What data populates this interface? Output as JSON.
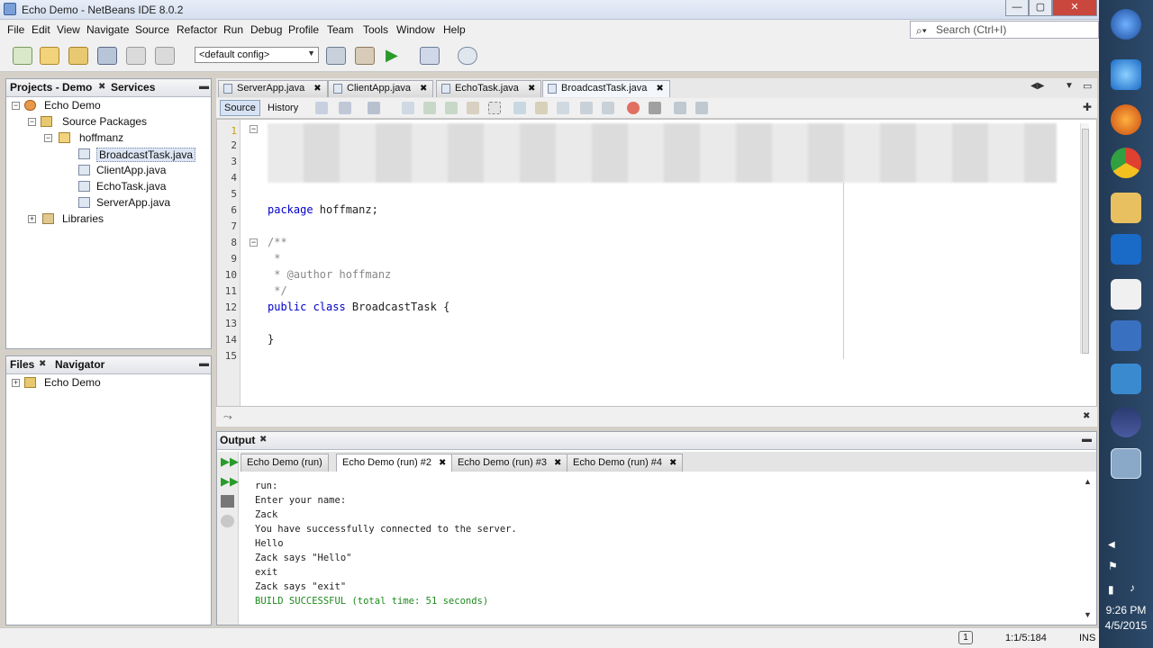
{
  "window": {
    "title": "Echo Demo - NetBeans IDE 8.0.2",
    "min_glyph": "—",
    "max_glyph": "▢",
    "close_glyph": "✕"
  },
  "menu": [
    "File",
    "Edit",
    "View",
    "Navigate",
    "Source",
    "Refactor",
    "Run",
    "Debug",
    "Profile",
    "Team",
    "Tools",
    "Window",
    "Help"
  ],
  "search": {
    "placeholder": "Search (Ctrl+I)"
  },
  "toolbar": {
    "config": "<default config>"
  },
  "projects_panel": {
    "tabs": [
      "Projects - Demo",
      "Services"
    ],
    "tree": {
      "project": "Echo Demo",
      "source_packages": "Source Packages",
      "package": "hoffmanz",
      "files": [
        "BroadcastTask.java",
        "ClientApp.java",
        "EchoTask.java",
        "ServerApp.java"
      ],
      "libraries": "Libraries"
    }
  },
  "files_panel": {
    "tabs": [
      "Files",
      "Navigator"
    ],
    "project": "Echo Demo"
  },
  "editor": {
    "tabs": [
      "ServerApp.java",
      "ClientApp.java",
      "EchoTask.java",
      "BroadcastTask.java"
    ],
    "active_tab": "BroadcastTask.java",
    "modes": [
      "Source",
      "History"
    ],
    "line_numbers": [
      "1",
      "2",
      "3",
      "4",
      "5",
      "6",
      "7",
      "8",
      "9",
      "10",
      "11",
      "12",
      "13",
      "14",
      "15"
    ],
    "code": {
      "l6_kw": "package",
      "l6_rest": " hoffmanz;",
      "l8": "/**",
      "l9": " *",
      "l10": " * @author hoffmanz",
      "l11": " */",
      "l12_kw": "public class",
      "l12_rest": " BroadcastTask {",
      "l14": "}"
    }
  },
  "output": {
    "title": "Output",
    "tabs": [
      "Echo Demo (run)",
      "Echo Demo (run) #2",
      "Echo Demo (run) #3",
      "Echo Demo (run) #4"
    ],
    "active_tab": "Echo Demo (run) #2",
    "lines": [
      "run:",
      "Enter your name:",
      "Zack",
      "You have successfully connected to the server.",
      "Hello",
      "Zack says \"Hello\"",
      "exit",
      "Zack says \"exit\""
    ],
    "build_line": "BUILD SUCCESSFUL (total time: 51 seconds)"
  },
  "status": {
    "notifications": "1",
    "position": "1:1/5:184",
    "mode": "INS"
  },
  "clock": {
    "time": "9:26 PM",
    "date": "4/5/2015"
  }
}
